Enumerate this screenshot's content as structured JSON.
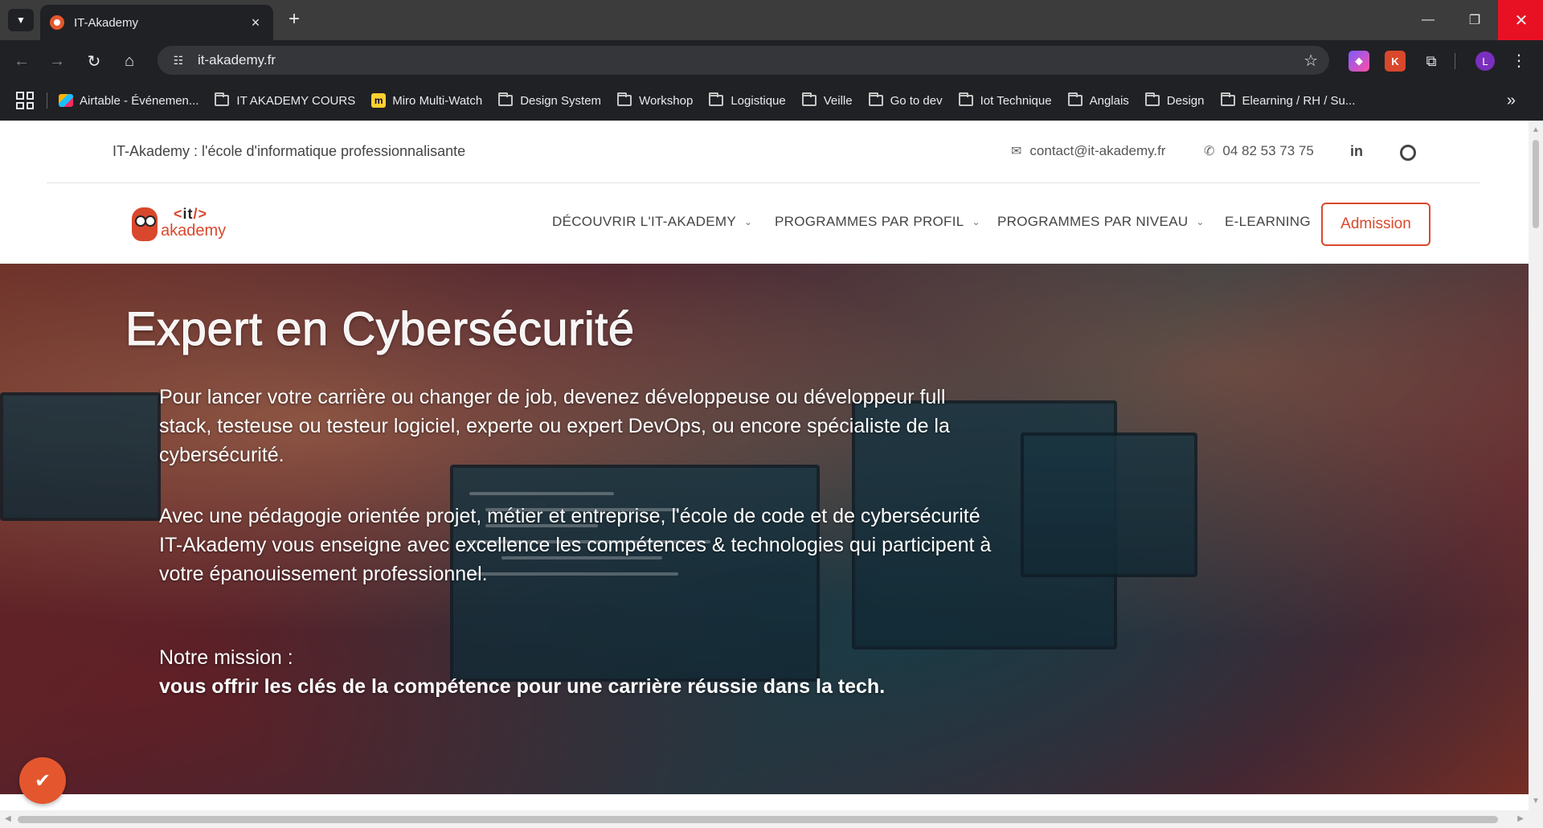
{
  "browser": {
    "tab_title": "IT-Akademy",
    "url": "it-akademy.fr",
    "profile_initial": "L",
    "bookmarks": [
      {
        "label": "Airtable - Événemen...",
        "icon": "airtable-icon"
      },
      {
        "label": "IT AKADEMY COURS",
        "icon": "folder-icon"
      },
      {
        "label": "Miro Multi-Watch",
        "icon": "miro-icon"
      },
      {
        "label": "Design System",
        "icon": "folder-icon"
      },
      {
        "label": "Workshop",
        "icon": "folder-icon"
      },
      {
        "label": "Logistique",
        "icon": "folder-icon"
      },
      {
        "label": "Veille",
        "icon": "folder-icon"
      },
      {
        "label": "Go to dev",
        "icon": "folder-icon"
      },
      {
        "label": "Iot Technique",
        "icon": "folder-icon"
      },
      {
        "label": "Anglais",
        "icon": "folder-icon"
      },
      {
        "label": "Design",
        "icon": "folder-icon"
      },
      {
        "label": "Elearning / RH / Su...",
        "icon": "folder-icon"
      }
    ]
  },
  "site": {
    "tagline": "IT-Akademy : l'école d'informatique professionnalisante",
    "email": "contact@it-akademy.fr",
    "phone": "04 82 53 73 75",
    "linkedin": "in",
    "logo": {
      "it": "it",
      "name": "akademy"
    },
    "menu": [
      "DÉCOUVRIR L'IT-AKADEMY",
      "PROGRAMMES PAR PROFIL",
      "PROGRAMMES PAR NIVEAU",
      "E-LEARNING"
    ],
    "admission_label": "Admission",
    "accent_color": "#d9482c"
  },
  "hero": {
    "title": "Expert en Cybersécurité",
    "paragraph1": "Pour lancer votre carrière ou changer de job, devenez développeuse ou développeur full stack, testeuse ou testeur logiciel, experte ou expert DevOps, ou encore spécialiste de la cybersécurité.",
    "paragraph2": "Avec une pédagogie orientée projet, métier et entreprise, l'école de code et de cybersécurité IT-Akademy vous enseigne avec excellence les compétences & technologies qui participent à votre épanouissement professionnel.",
    "mission_label": "Notre mission :",
    "mission_text": "vous offrir les clés de la compétence pour une carrière réussie dans la tech."
  }
}
